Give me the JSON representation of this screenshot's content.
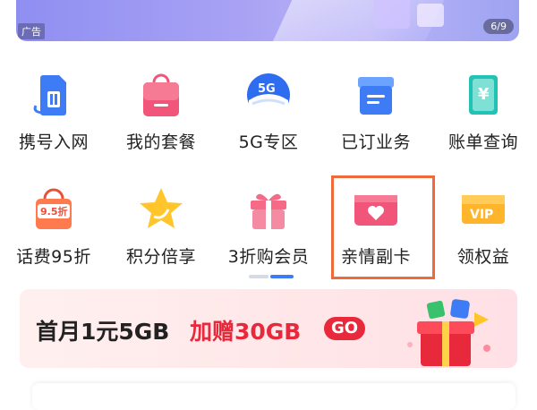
{
  "ad": {
    "label": "广告",
    "counter": "6/9"
  },
  "grid": {
    "items": [
      {
        "label": "携号入网",
        "icon": "sim-card-icon"
      },
      {
        "label": "我的套餐",
        "icon": "shopping-bag-icon"
      },
      {
        "label": "5G专区",
        "icon": "5g-icon"
      },
      {
        "label": "已订业务",
        "icon": "business-box-icon"
      },
      {
        "label": "账单查询",
        "icon": "bill-icon"
      },
      {
        "label": "话费95折",
        "icon": "discount-bag-icon"
      },
      {
        "label": "积分倍享",
        "icon": "star-icon"
      },
      {
        "label": "3折购会员",
        "icon": "gift-box-icon"
      },
      {
        "label": "亲情副卡",
        "icon": "heart-card-icon"
      },
      {
        "label": "领权益",
        "icon": "vip-ticket-icon"
      }
    ],
    "discount_badge": "9.5折",
    "vip_text": "VIP",
    "fiveg_text": "5G"
  },
  "promo": {
    "text_main": "首月1元5GB",
    "text_extra": "加赠30GB",
    "go_label": "GO"
  },
  "colors": {
    "blue": "#3d7cf5",
    "pink": "#f2557a",
    "red": "#e8283b",
    "highlight": "#ef6a3a"
  }
}
